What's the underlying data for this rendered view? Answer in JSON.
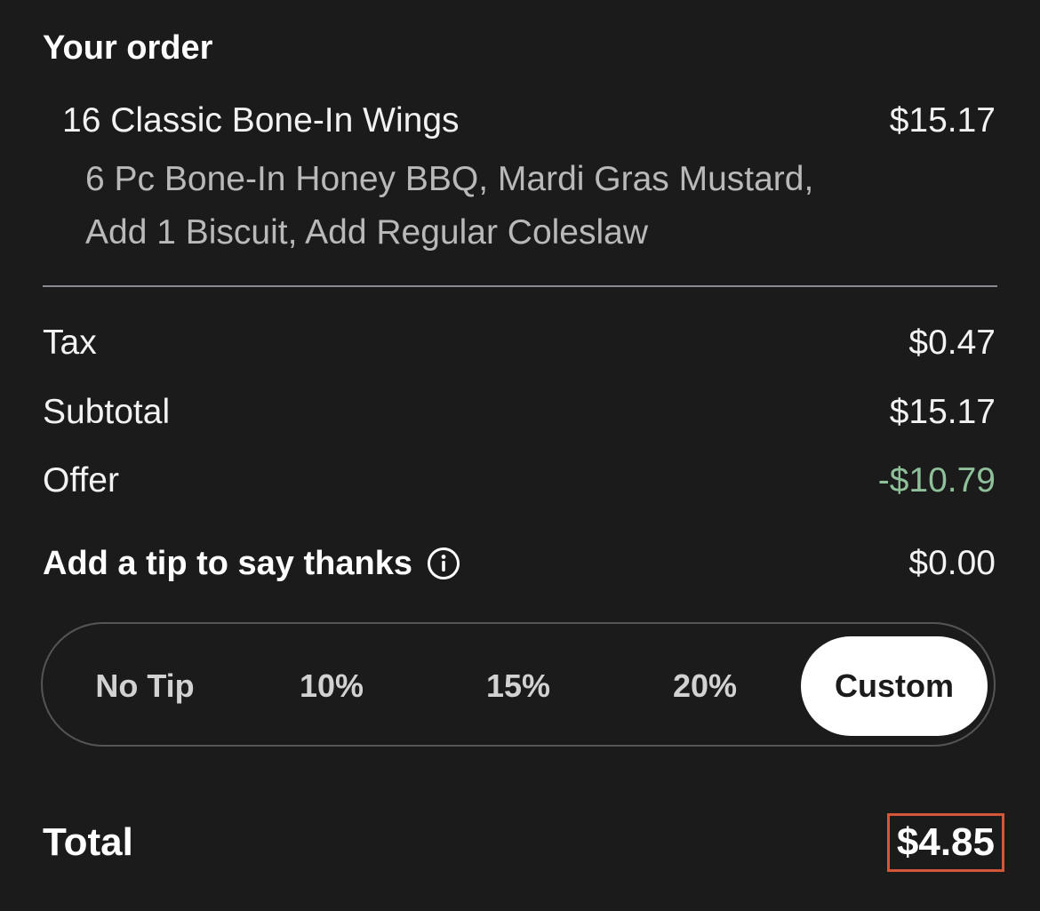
{
  "order": {
    "title": "Your order",
    "item": {
      "name": "16 Classic Bone-In Wings",
      "price": "$15.17",
      "modifiers_line1": "6 Pc Bone-In Honey BBQ, Mardi Gras Mustard,",
      "modifiers_line2": "Add 1 Biscuit, Add Regular Coleslaw"
    }
  },
  "summary": {
    "tax_label": "Tax",
    "tax_value": "$0.47",
    "subtotal_label": "Subtotal",
    "subtotal_value": "$15.17",
    "offer_label": "Offer",
    "offer_value": "-$10.79",
    "offer_color": "#8ec09a"
  },
  "tip": {
    "label": "Add a tip to say thanks",
    "icon": "info-icon",
    "value": "$0.00",
    "options": [
      "No Tip",
      "10%",
      "15%",
      "20%",
      "Custom"
    ],
    "selected": "Custom"
  },
  "total": {
    "label": "Total",
    "value": "$4.85",
    "highlight_color": "#d4573a"
  }
}
